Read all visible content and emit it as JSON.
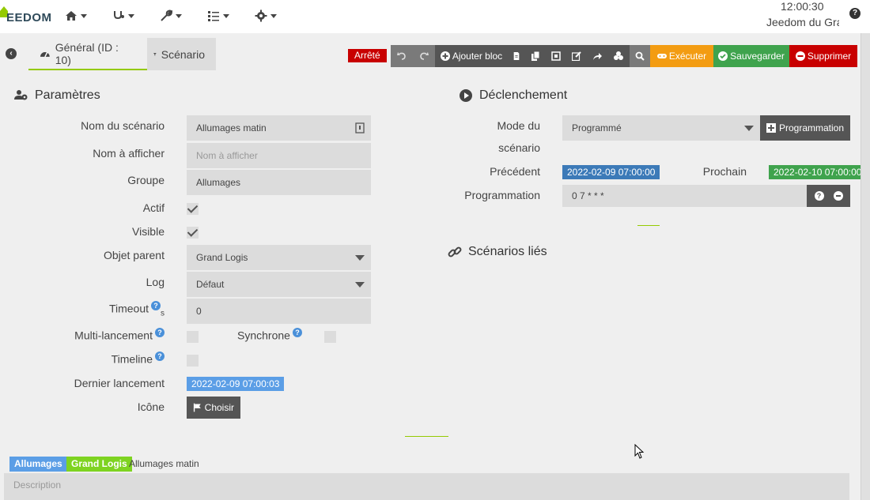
{
  "nav": {
    "logo_text": "EEDOM",
    "clock": "12:00:30",
    "site_name": "Jeedom du Gra",
    "items": [
      {
        "icon": "home-icon"
      },
      {
        "icon": "stethoscope-icon"
      },
      {
        "icon": "wrench-icon"
      },
      {
        "icon": "tasks-icon"
      },
      {
        "icon": "gear-icon"
      }
    ]
  },
  "tabs": {
    "general": "Général (ID : 10)",
    "scenario": "Scénario"
  },
  "status": {
    "state": "Arrêté"
  },
  "toolbar": {
    "add_block": "Ajouter bloc",
    "execute": "Exécuter",
    "save": "Sauvegarder",
    "delete": "Supprimer"
  },
  "params": {
    "title": "Paramètres",
    "name_label": "Nom du scénario",
    "name_value": "Allumages matin",
    "display_label": "Nom à afficher",
    "display_placeholder": "Nom à afficher",
    "group_label": "Groupe",
    "group_value": "Allumages",
    "active_label": "Actif",
    "visible_label": "Visible",
    "parent_label": "Objet parent",
    "parent_value": "Grand Logis",
    "log_label": "Log",
    "log_value": "Défaut",
    "timeout_label": "Timeout",
    "timeout_unit": "s",
    "timeout_value": "0",
    "multi_label": "Multi-lancement",
    "sync_label": "Synchrone",
    "timeline_label": "Timeline",
    "last_run_label": "Dernier lancement",
    "last_run_value": "2022-02-09 07:00:03",
    "icon_label": "Icône",
    "choose_label": "Choisir"
  },
  "trigger": {
    "title": "Déclenchement",
    "mode_label_1": "Mode du",
    "mode_label_2": "scénario",
    "mode_value": "Programmé",
    "programmation_button": "Programmation",
    "previous_label": "Précédent",
    "previous_value": "2022-02-09 07:00:00",
    "next_label": "Prochain",
    "next_value": "2022-02-10 07:00:00",
    "schedule_label": "Programmation",
    "schedule_value": "0 7 * * *"
  },
  "linked": {
    "title": "Scénarios liés"
  },
  "footer": {
    "tag_group": "Allumages",
    "tag_object": "Grand Logis",
    "tag_name": "Allumages matin",
    "description_placeholder": "Description"
  },
  "colors": {
    "accent_green": "#94ca02",
    "badge_blue": "#3c7ab8",
    "badge_green": "#3fa34d",
    "last_run_blue": "#5b9ee6",
    "tag_green": "#7ed321",
    "stopped_red": "#c80000",
    "execute_orange": "#f39c12"
  }
}
